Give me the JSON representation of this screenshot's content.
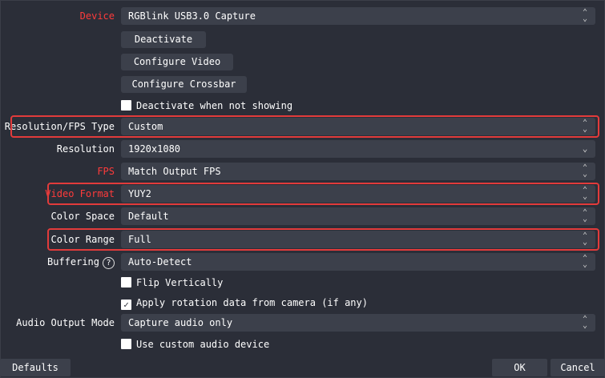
{
  "device": {
    "label": "Device",
    "value": "RGBlink USB3.0 Capture"
  },
  "buttons": {
    "deactivate": "Deactivate",
    "configure_video": "Configure Video",
    "configure_crossbar": "Configure Crossbar"
  },
  "deactivate_when_not_showing": {
    "label": "Deactivate when not showing",
    "checked": false
  },
  "resolution_fps_type": {
    "label": "Resolution/FPS Type",
    "value": "Custom"
  },
  "resolution": {
    "label": "Resolution",
    "value": "1920x1080"
  },
  "fps": {
    "label": "FPS",
    "value": "Match Output FPS"
  },
  "video_format": {
    "label": "Video Format",
    "value": "YUY2"
  },
  "color_space": {
    "label": "Color Space",
    "value": "Default"
  },
  "color_range": {
    "label": "Color Range",
    "value": "Full"
  },
  "buffering": {
    "label": "Buffering",
    "value": "Auto-Detect",
    "help_glyph": "?"
  },
  "flip_vertically": {
    "label": "Flip Vertically",
    "checked": false
  },
  "apply_rotation": {
    "label": "Apply rotation data from camera (if any)",
    "checked": true,
    "check_glyph": "✓"
  },
  "audio_output_mode": {
    "label": "Audio Output Mode",
    "value": "Capture audio only"
  },
  "use_custom_audio": {
    "label": "Use custom audio device",
    "checked": false
  },
  "footer": {
    "defaults": "Defaults",
    "ok": "OK",
    "cancel": "Cancel"
  },
  "colors": {
    "background": "#2b2e38",
    "control": "#3c404b",
    "highlight": "#e23b3b",
    "red_label": "#ff3b3b"
  }
}
